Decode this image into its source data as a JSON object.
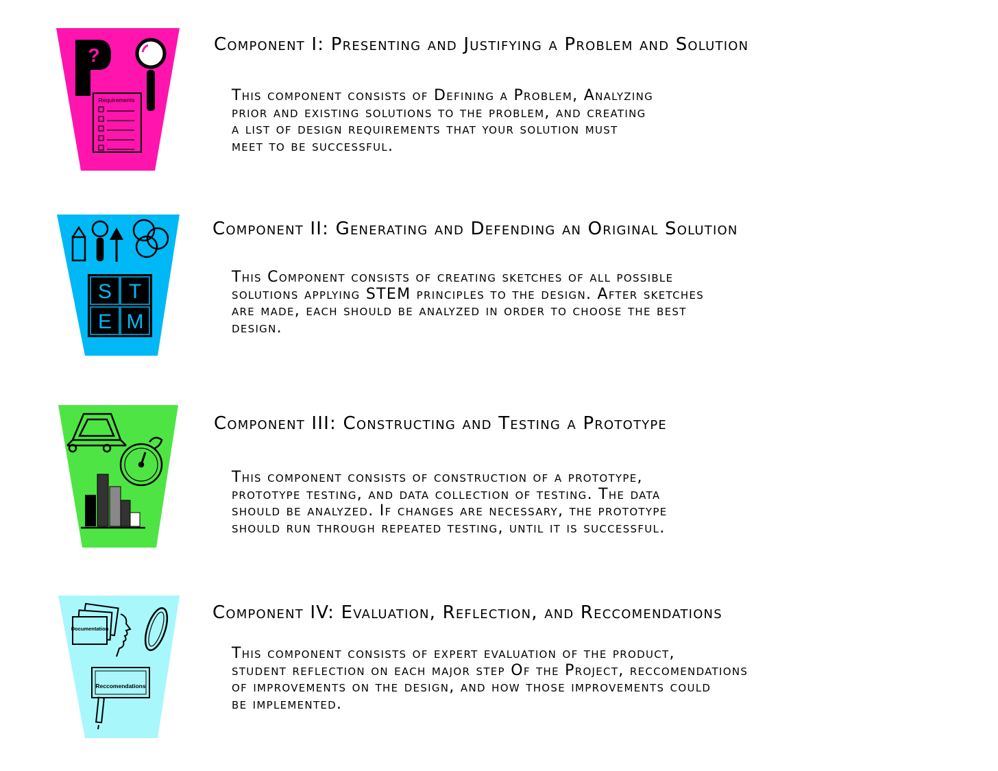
{
  "components": [
    {
      "title": "Component I:  Presenting and Justifying a Problem and Solution",
      "color": "#ff14ae",
      "icons": [
        "p-letter-icon",
        "question-mark-icon",
        "magnifier-i-icon",
        "requirements-checklist-icon"
      ],
      "icon_text": {
        "checklist": "Requirements"
      },
      "lines": [
        "This component consists of Defining a Problem, Analyzing",
        "prior and existing solutions to the problem, and creating",
        "a list of design requirements that your solution must",
        "meet to be successful."
      ]
    },
    {
      "title": "Component II:  Generating and Defending an Original Solution",
      "color": "#00b8f5",
      "icons": [
        "pencil-icon",
        "magnifier-i-icon",
        "arrow-up-icon",
        "venn-circles-icon",
        "stem-grid-icon"
      ],
      "icon_text": {
        "stem": [
          "S",
          "T",
          "E",
          "M"
        ]
      },
      "lines": [
        "This Component consists of creating sketches of all possible",
        "solutions applying STEM principles to the design. After sketches",
        "are made, each should be analyzed in order to choose the best",
        "design."
      ]
    },
    {
      "title": "Component III:  Constructing and Testing a Prototype",
      "color": "#4ee544",
      "icons": [
        "cart-prototype-icon",
        "stopwatch-icon",
        "bar-graph-icon"
      ],
      "icon_text": {},
      "lines": [
        "This component consists of construction of a prototype,",
        "prototype testing, and data collection of testing. The data",
        "should be analyzed. If changes are necessary, the prototype",
        "should run through repeated testing, until it is successful."
      ]
    },
    {
      "title": "Component IV:  Evaluation, Reflection, and Reccomendations",
      "color": "#a8f7fb",
      "icons": [
        "documentation-folder-icon",
        "face-profile-icon",
        "mirror-icon",
        "recommendations-board-icon",
        "pen-icon"
      ],
      "icon_text": {
        "documentation": "Documentation",
        "board": "Reccomendations"
      },
      "lines": [
        "This component consists of expert evaluation of the product,",
        "student reflection on each major step Of the Project, reccomendations",
        "of improvements on the design, and how those improvements could",
        "be implemented."
      ]
    }
  ]
}
